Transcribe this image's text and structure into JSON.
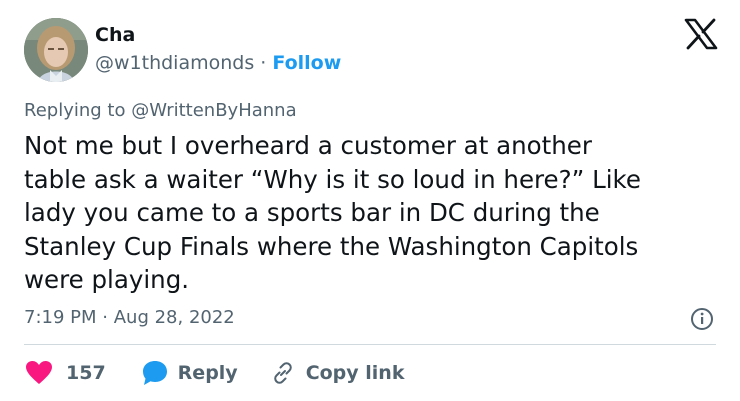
{
  "author": {
    "name": "Cha",
    "handle": "@w1thdiamonds",
    "separator": "·",
    "follow_label": "Follow"
  },
  "icons": {
    "brand": "x-logo-icon",
    "info": "info-icon",
    "like": "heart-icon",
    "reply": "reply-bubble-icon",
    "copy": "link-icon"
  },
  "colors": {
    "accent": "#1d9bf0",
    "like": "#f91880",
    "muted": "#536471"
  },
  "reply_context": {
    "prefix": "Replying to",
    "mention": "@WrittenByHanna"
  },
  "tweet": {
    "lines": [
      "Not me but I overheard a customer at another",
      "table ask a waiter “Why is it so loud in here?” Like",
      "lady you came to a sports bar in DC during the",
      "Stanley Cup Finals where the Washington Capitols",
      "were playing."
    ],
    "time": "7:19 PM",
    "time_separator": "·",
    "date": "Aug 28, 2022"
  },
  "actions": {
    "like_count": "157",
    "reply_label": "Reply",
    "copy_label": "Copy link"
  }
}
